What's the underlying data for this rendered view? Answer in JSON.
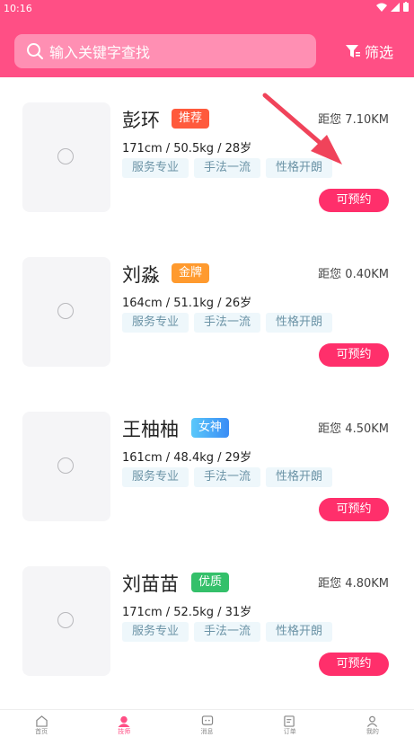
{
  "status": {
    "time": "10:16"
  },
  "search": {
    "placeholder": "输入关键字查找"
  },
  "filter": {
    "label": "筛选"
  },
  "cards": [
    {
      "name": "彭环",
      "badge": "推荐",
      "badge_color": "#ff5a3c",
      "distance": "距您 7.10KM",
      "stats": "171cm / 50.5kg / 28岁",
      "tags": [
        "服务专业",
        "手法一流",
        "性格开朗"
      ],
      "book": "可预约"
    },
    {
      "name": "刘淼",
      "badge": "金牌",
      "badge_color": "#ff9a2e",
      "distance": "距您 0.40KM",
      "stats": "164cm / 51.1kg / 26岁",
      "tags": [
        "服务专业",
        "手法一流",
        "性格开朗"
      ],
      "book": "可预约"
    },
    {
      "name": "王柚柚",
      "badge": "女神",
      "badge_color": "#3aa9f5",
      "distance": "距您 4.50KM",
      "stats": "161cm / 48.4kg / 29岁",
      "tags": [
        "服务专业",
        "手法一流",
        "性格开朗"
      ],
      "book": "可预约"
    },
    {
      "name": "刘苗苗",
      "badge": "优质",
      "badge_color": "#34c06a",
      "distance": "距您 4.80KM",
      "stats": "171cm / 52.5kg / 31岁",
      "tags": [
        "服务专业",
        "手法一流",
        "性格开朗"
      ],
      "book": "可预约"
    }
  ],
  "tabs": [
    {
      "label": "首页",
      "icon": "home-icon"
    },
    {
      "label": "技师",
      "icon": "person-icon",
      "active": true
    },
    {
      "label": "消息",
      "icon": "message-icon"
    },
    {
      "label": "订单",
      "icon": "order-icon"
    },
    {
      "label": "我的",
      "icon": "user-icon"
    }
  ],
  "colors": {
    "brand": "#ff4f85",
    "button": "#ff2f6b",
    "arrow": "#f0435a"
  }
}
